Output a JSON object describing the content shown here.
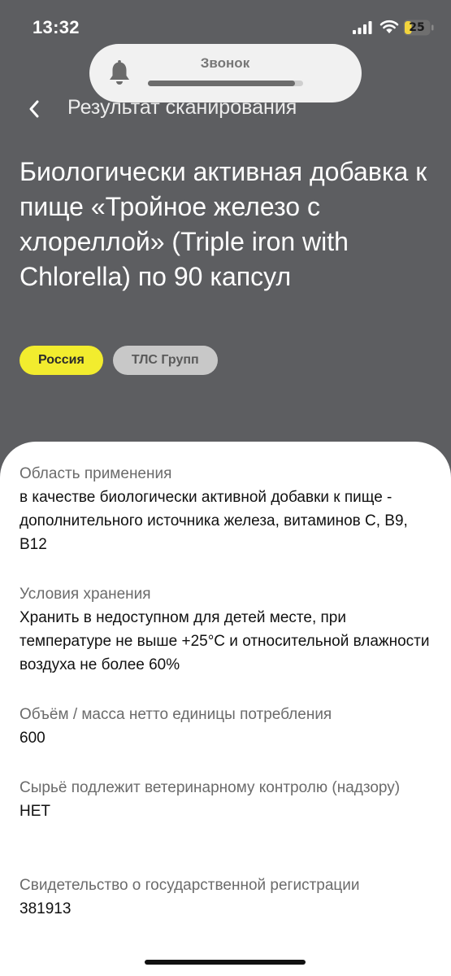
{
  "status_bar": {
    "time": "13:32",
    "battery_level": "25"
  },
  "call_banner": {
    "label": "Звонок",
    "progress": 0.95,
    "icon": "bell-icon"
  },
  "nav": {
    "back_icon": "chevron-left-icon",
    "title": "Результат сканирования"
  },
  "product": {
    "title": "Биологически активная добавка к пище «Тройное железо с хлореллой» (Triple iron with Chlorella) по 90 капсул",
    "tags": [
      "Россия",
      "ТЛС Групп"
    ]
  },
  "details": [
    {
      "label": "Область применения",
      "value": "в качестве биологически активной добавки к пище - дополнительного источника железа, витаминов С, В9, В12"
    },
    {
      "label": "Условия хранения",
      "value": "Хранить в недоступном для детей месте, при температуре не выше +25°С и относительной влажности воздуха не более 60%"
    },
    {
      "label": "Объём / масса нетто единицы потребления",
      "value": "600"
    },
    {
      "label": "Сырьё подлежит ветеринарному контролю (надзору)",
      "value": "НЕТ"
    },
    {
      "label": "Свидетельство о государственной регистрации",
      "value": "381913"
    }
  ],
  "colors": {
    "background": "#5d5e61",
    "accent_tag": "#f2ec2e",
    "secondary_tag": "#c8c8c8",
    "sheet": "#ffffff"
  }
}
